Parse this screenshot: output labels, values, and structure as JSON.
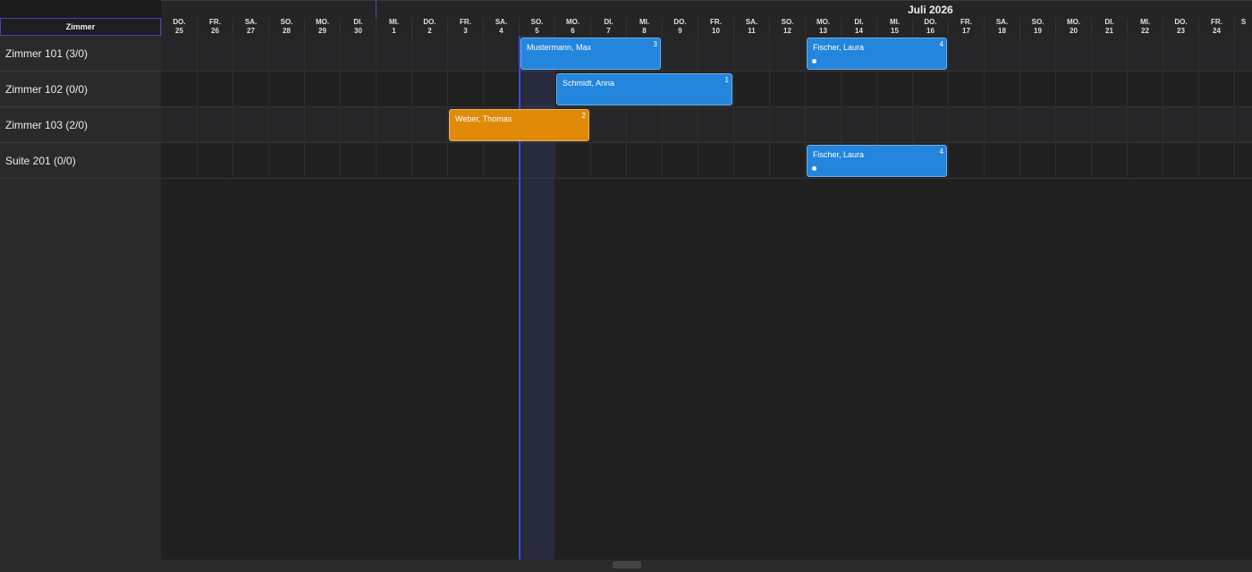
{
  "timeline": {
    "month_label": "Juli 2026",
    "column_header": "Zimmer",
    "days": [
      {
        "wd": "DO.",
        "d": "25"
      },
      {
        "wd": "FR.",
        "d": "26"
      },
      {
        "wd": "SA.",
        "d": "27"
      },
      {
        "wd": "SO.",
        "d": "28"
      },
      {
        "wd": "MO.",
        "d": "29"
      },
      {
        "wd": "DI.",
        "d": "30"
      },
      {
        "wd": "MI.",
        "d": "1"
      },
      {
        "wd": "DO.",
        "d": "2"
      },
      {
        "wd": "FR.",
        "d": "3"
      },
      {
        "wd": "SA.",
        "d": "4"
      },
      {
        "wd": "SO.",
        "d": "5"
      },
      {
        "wd": "MO.",
        "d": "6"
      },
      {
        "wd": "DI.",
        "d": "7"
      },
      {
        "wd": "MI.",
        "d": "8"
      },
      {
        "wd": "DO.",
        "d": "9"
      },
      {
        "wd": "FR.",
        "d": "10"
      },
      {
        "wd": "SA.",
        "d": "11"
      },
      {
        "wd": "SO.",
        "d": "12"
      },
      {
        "wd": "MO.",
        "d": "13"
      },
      {
        "wd": "DI.",
        "d": "14"
      },
      {
        "wd": "MI.",
        "d": "15"
      },
      {
        "wd": "DO.",
        "d": "16"
      },
      {
        "wd": "FR.",
        "d": "17"
      },
      {
        "wd": "SA.",
        "d": "18"
      },
      {
        "wd": "SO.",
        "d": "19"
      },
      {
        "wd": "MO.",
        "d": "20"
      },
      {
        "wd": "DI.",
        "d": "21"
      },
      {
        "wd": "MI.",
        "d": "22"
      },
      {
        "wd": "DO.",
        "d": "23"
      },
      {
        "wd": "FR.",
        "d": "24"
      },
      {
        "wd": "S",
        "d": ""
      }
    ]
  },
  "rooms": [
    {
      "label": "Zimmer 101 (3/0)"
    },
    {
      "label": "Zimmer 102 (0/0)"
    },
    {
      "label": "Zimmer 103 (2/0)"
    },
    {
      "label": "Suite 201 (0/0)"
    }
  ],
  "bookings": [
    {
      "guest": "Mustermann, Max",
      "count": "3",
      "color": "#2385dc",
      "status": "blue"
    },
    {
      "guest": "Fischer, Laura",
      "count": "4",
      "color": "#2385dc",
      "status": "blue"
    },
    {
      "guest": "Schmidt, Anna",
      "count": "1",
      "color": "#2385dc",
      "status": "blue"
    },
    {
      "guest": "Weber, Thomas",
      "count": "2",
      "color": "#e08a08",
      "status": "orange"
    },
    {
      "guest": "Fischer, Laura",
      "count": "4",
      "color": "#2385dc",
      "status": "blue"
    }
  ],
  "colors": {
    "booked": "#2385dc",
    "pending": "#e08a08",
    "today_line": "#3d49d8"
  }
}
